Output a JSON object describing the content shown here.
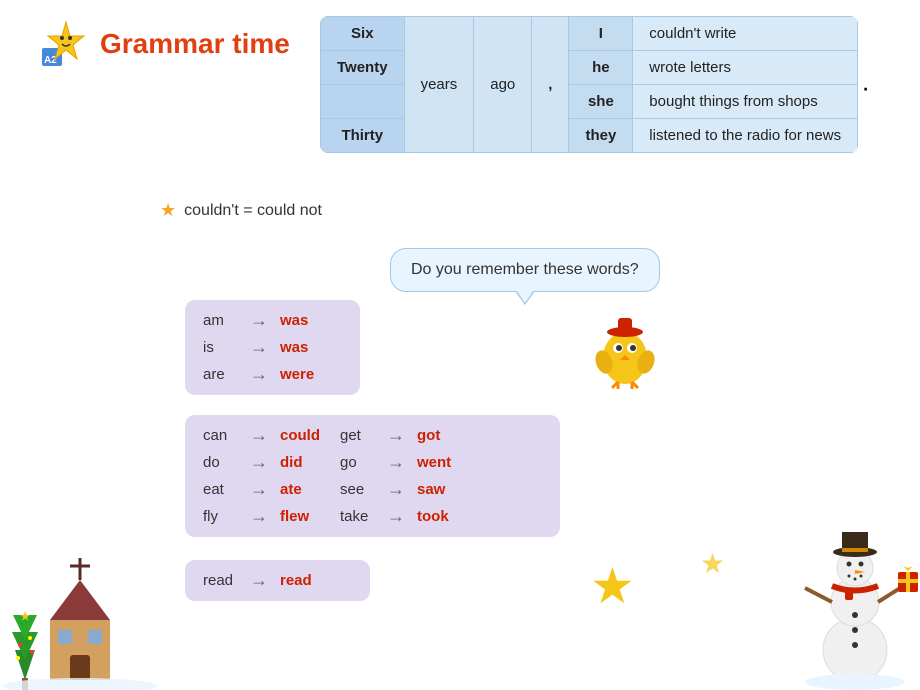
{
  "header": {
    "title": "Grammar time"
  },
  "table": {
    "rows": [
      {
        "number": "Six",
        "pronoun": "I",
        "phrase": "couldn't write"
      },
      {
        "number": "Twenty",
        "pronoun": "he",
        "phrase": "wrote letters"
      },
      {
        "number": "",
        "pronoun": "she",
        "phrase": "bought things from shops"
      },
      {
        "number": "Thirty",
        "pronoun": "they",
        "phrase": "listened to the radio for news"
      }
    ],
    "years_label": "years",
    "ago_label": "ago",
    "comma": ","
  },
  "note": {
    "text": "couldn't = could not"
  },
  "speech_bubble": {
    "text": "Do you remember these words?"
  },
  "word_groups": {
    "group1": {
      "pairs": [
        {
          "present": "am",
          "past": "was"
        },
        {
          "present": "is",
          "past": "was"
        },
        {
          "present": "are",
          "past": "were"
        }
      ]
    },
    "group2": {
      "pairs": [
        {
          "present": "can",
          "past": "could"
        },
        {
          "present": "do",
          "past": "did"
        },
        {
          "present": "eat",
          "past": "ate"
        },
        {
          "present": "fly",
          "past": "flew"
        },
        {
          "present": "get",
          "past": "got"
        },
        {
          "present": "go",
          "past": "went"
        },
        {
          "present": "see",
          "past": "saw"
        },
        {
          "present": "take",
          "past": "took"
        }
      ]
    },
    "group3": {
      "pairs": [
        {
          "present": "read",
          "past": "read"
        }
      ]
    }
  },
  "arrow_symbol": "→"
}
